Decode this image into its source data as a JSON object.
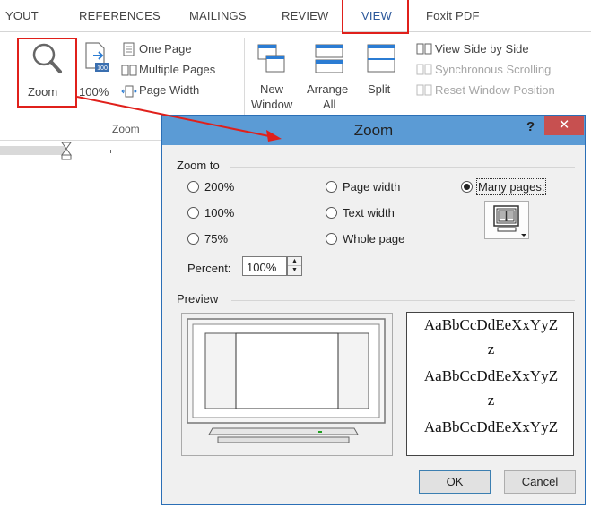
{
  "ribbon": {
    "tabs": [
      {
        "label": "YOUT"
      },
      {
        "label": "REFERENCES"
      },
      {
        "label": "MAILINGS"
      },
      {
        "label": "REVIEW"
      },
      {
        "label": "VIEW",
        "active": true
      },
      {
        "label": "Foxit PDF"
      }
    ],
    "zoom_group": {
      "zoom_label": "Zoom",
      "hundred_label": "100%",
      "hundred_icon_text": "100",
      "one_page": "One Page",
      "multiple_pages": "Multiple Pages",
      "page_width": "Page Width",
      "group_label": "Zoom"
    },
    "window_group": {
      "new_window_line1": "New",
      "new_window_line2": "Window",
      "arrange_all_line1": "Arrange",
      "arrange_all_line2": "All",
      "split": "Split",
      "view_side_by_side": "View Side by Side",
      "synchronous_scrolling": "Synchronous Scrolling",
      "reset_window_position": "Reset Window Position"
    }
  },
  "dialog": {
    "title": "Zoom",
    "help": "?",
    "close": "✕",
    "zoom_to_label": "Zoom to",
    "options": {
      "p200": "200%",
      "p100": "100%",
      "p75": "75%",
      "page_width": "Page width",
      "text_width": "Text width",
      "whole_page": "Whole page",
      "many_pages": "Many pages:"
    },
    "selected_option": "many_pages",
    "percent_label": "Percent:",
    "percent_value": "100%",
    "preview_label": "Preview",
    "sample_lines": [
      "AaBbCcDdEeXxYyZ",
      "z",
      "AaBbCcDdEeXxYyZ",
      "z",
      "AaBbCcDdEeXxYyZ"
    ],
    "ok_label": "OK",
    "cancel_label": "Cancel"
  },
  "colors": {
    "annotation_red": "#e0201b",
    "dialog_titlebar": "#5b9bd5",
    "close_button": "#c75050",
    "active_tab": "#2b579a"
  }
}
